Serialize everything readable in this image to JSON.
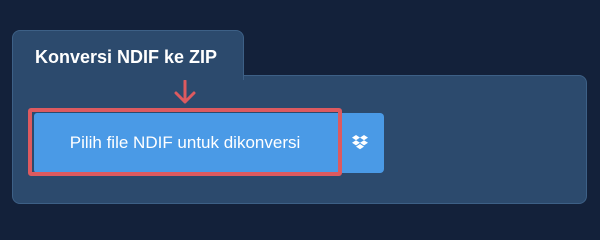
{
  "tab": {
    "title": "Konversi NDIF ke ZIP"
  },
  "upload": {
    "select_label": "Pilih file NDIF untuk dikonversi",
    "dropbox_icon": "dropbox-icon"
  },
  "colors": {
    "background": "#13213a",
    "panel": "#2c4a6d",
    "button": "#4a9ae6",
    "highlight": "#dd5a5f"
  }
}
